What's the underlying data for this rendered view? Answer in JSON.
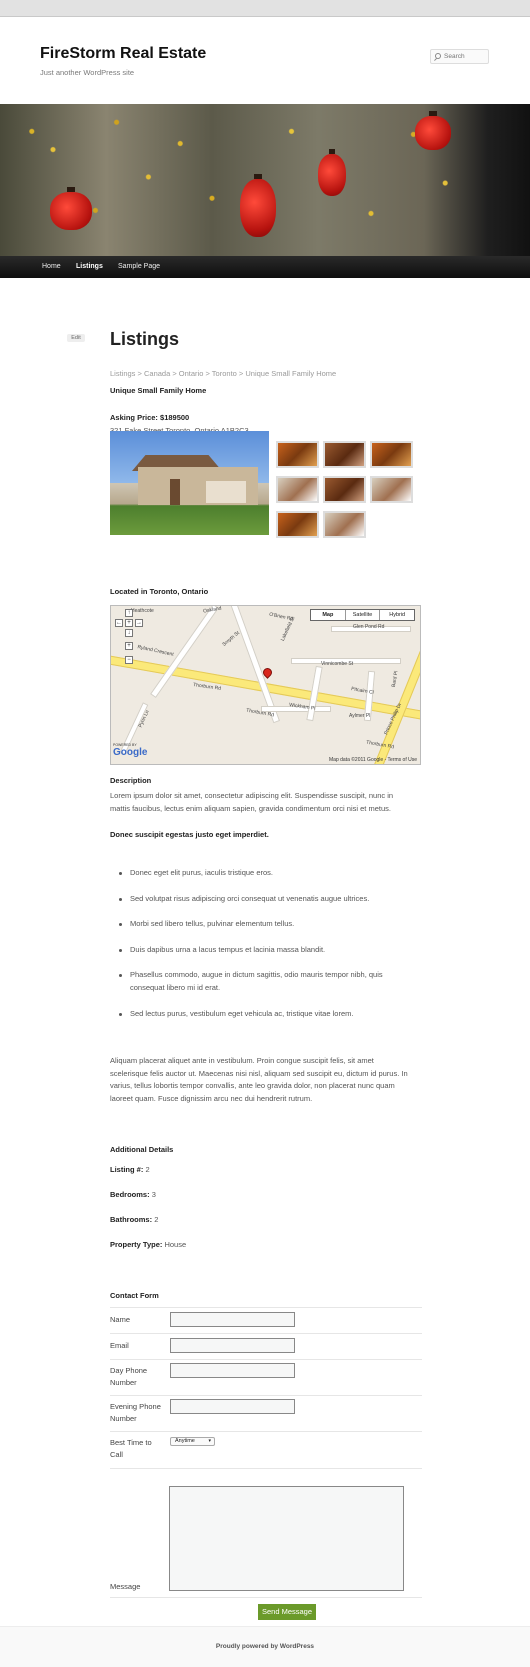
{
  "site": {
    "title": "FireStorm Real Estate",
    "tagline": "Just another WordPress site",
    "search_placeholder": "Search"
  },
  "nav": {
    "items": [
      "Home",
      "Listings",
      "Sample Page"
    ],
    "current": "Listings"
  },
  "post": {
    "edit_label": "Edit",
    "title": "Listings",
    "breadcrumb": "Listings > Canada > Ontario > Toronto > Unique Small Family Home",
    "listing_title": "Unique Small Family Home",
    "asking_price_label": "Asking Price:",
    "asking_price_value": "$189500",
    "address": "321 Fake Street Toronto, Ontario A1B2C3"
  },
  "map": {
    "heading": "Located in Toronto, Ontario",
    "tabs": [
      "Map",
      "Satellite",
      "Hybrid"
    ],
    "streets": [
      "Thorburn Rd",
      "Thorburn Rd",
      "Thorburn Rd",
      "Lakefield St",
      "O'Brien Rd",
      "Wickham Pl",
      "Vinnicombe St",
      "Glen Pond Rd",
      "Aylmer Pl",
      "Bard Pl",
      "Prince Philip Dr",
      "Pitcairn Cl",
      "Pynn Ln",
      "Ryland Crescent",
      "Heathcote",
      "Smyth St",
      "Oakland"
    ],
    "powered_by": "POWERED BY",
    "google": "Google",
    "copyright": "Map data ©2011 Google - Terms of Use"
  },
  "description": {
    "heading": "Description",
    "para1": "Lorem ipsum dolor sit amet, consectetur adipiscing elit. Suspendisse suscipit, nunc in mattis faucibus, lectus enim aliquam sapien, gravida condimentum orci nisi et metus.",
    "subheading": "Donec suscipit egestas justo eget imperdiet.",
    "list": [
      "Donec eget elit purus, iaculis tristique eros.",
      "Sed volutpat risus adipiscing orci consequat ut venenatis augue ultrices.",
      "Morbi sed libero tellus, pulvinar elementum tellus.",
      "Duis dapibus urna a lacus tempus et lacinia massa blandit.",
      "Phasellus commodo, augue in dictum sagittis, odio mauris tempor nibh, quis consequat libero mi id erat.",
      "Sed lectus purus, vestibulum eget vehicula ac, tristique vitae lorem."
    ],
    "para2": "Aliquam placerat aliquet ante in vestibulum. Proin congue suscipit felis, sit amet scelerisque felis auctor ut. Maecenas nisi nisl, aliquam sed suscipit eu, dictum id purus. In varius, tellus lobortis tempor convallis, ante leo gravida dolor, non placerat nunc quam laoreet quam. Fusce dignissim arcu nec dui hendrerit rutrum."
  },
  "details": {
    "heading": "Additional Details",
    "listing_label": "Listing #:",
    "listing_value": "2",
    "bedrooms_label": "Bedrooms:",
    "bedrooms_value": "3",
    "bathrooms_label": "Bathrooms:",
    "bathrooms_value": "2",
    "type_label": "Property Type:",
    "type_value": "House"
  },
  "contact": {
    "heading": "Contact Form",
    "name_label": "Name",
    "email_label": "Email",
    "day_phone_label": "Day Phone Number",
    "evening_phone_label": "Evening Phone Number",
    "best_time_label": "Best Time to Call",
    "best_time_value": "Anytime",
    "message_label": "Message",
    "submit_label": "Send Message"
  },
  "footer": {
    "text": "Proudly powered by WordPress"
  }
}
